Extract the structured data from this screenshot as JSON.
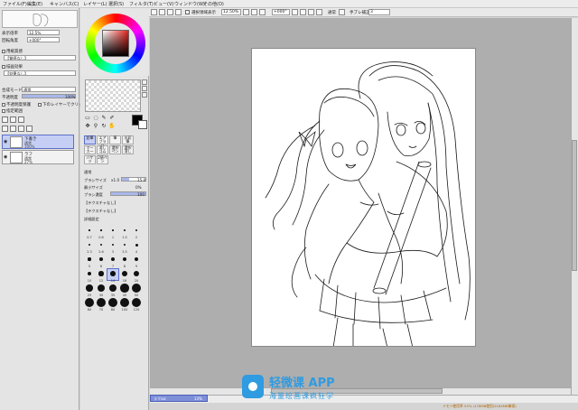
{
  "menu": {
    "items": [
      "ファイル(F)",
      "編集(E)",
      "キャンバス(C)",
      "レイヤー(L)",
      "選択(S)",
      "フィルタ(T)",
      "ビュー(V)",
      "ウィンドウ(W)",
      "その他(O)"
    ]
  },
  "toolbar": {
    "selection_label": "選択領域表示",
    "zoom_value": "12.50%",
    "rotation_value": "+000°",
    "blend_mode_label": "通常",
    "stabilizer_label": "手ブレ補正",
    "stabilizer_value": "3"
  },
  "navigator": {
    "zoom_label": "表示倍率",
    "zoom_value": "12.5%",
    "angle_label": "回転角度",
    "angle_value": "+000°"
  },
  "paper": {
    "texture_title": "用紙質感",
    "texture_value": "【質感なし】",
    "effect_title": "描画効果",
    "effect_value": "【効果なし】"
  },
  "layer_props": {
    "mode_label": "合成モード",
    "mode_value": "通常",
    "opacity_label": "不透明度",
    "opacity_value": "100%",
    "preserve_label": "不透明度保護",
    "clip_label": "下のレイヤーでクリッピング",
    "ref_label": "指定範囲"
  },
  "layers": [
    {
      "name": "下書き",
      "mode": "通常",
      "opacity": "100%",
      "selected": true
    },
    {
      "name": "ラフ",
      "mode": "通常",
      "opacity": "27%",
      "selected": false
    }
  ],
  "tools": {
    "labels": [
      "鉛筆",
      "エアブラシ",
      "筆",
      "水彩筆",
      "マーカー",
      "消しゴム",
      "選択ペン",
      "選択消し",
      "バケツ",
      "2値ペン"
    ]
  },
  "brush": {
    "blend_mode": "通常",
    "size_label": "ブラシサイズ",
    "size_multiplier": "x1.0",
    "size_value": "15.0",
    "min_size_label": "最小サイズ",
    "min_size_value": "0%",
    "density_label": "ブラシ濃度",
    "density_value": "100",
    "shape_label": "【テクスチャなし】",
    "texture_label": "【テクスチャなし】",
    "detail_label": "詳細設定",
    "sizes": [
      "0.7",
      "0.8",
      "1",
      "1.5",
      "2",
      "2.3",
      "2.6",
      "3",
      "3.5",
      "4",
      "5",
      "6",
      "7",
      "8",
      "9",
      "10",
      "12",
      "14",
      "16",
      "20",
      "25",
      "30",
      "35",
      "40",
      "50",
      "60",
      "70",
      "80",
      "100",
      "120",
      "160",
      "200",
      "250",
      "300",
      "350",
      "400",
      "500"
    ],
    "selected_size": "14",
    "size_progress": 0.3,
    "density_progress": 1.0
  },
  "document": {
    "name": "ラフsai",
    "zoom": "13%"
  },
  "status": {
    "info": "メモリ使用率 53% (178MB使用/2184MB確保)"
  },
  "watermark": {
    "title": "轻微课 APP",
    "subtitle": "海量绘画课疯狂学"
  },
  "colors": {
    "accent": "#c5cff5",
    "accent_border": "#5d6fc8",
    "watermark_blue": "#2f9be0",
    "fg_color": "#000000",
    "bg_color": "#ffffff"
  }
}
